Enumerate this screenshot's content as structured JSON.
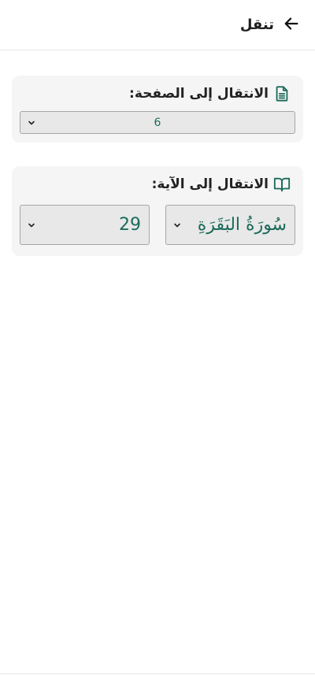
{
  "header": {
    "title": "تنقل",
    "back_icon": "arrow-left-icon"
  },
  "page_nav": {
    "label": "الانتقال إلى الصفحة:",
    "icon": "document-icon",
    "selected_page": "6"
  },
  "ayah_nav": {
    "label": "الانتقال إلى الآية:",
    "icon": "open-book-icon",
    "selected_surah": "سُورَةُ البَقَرَةِ",
    "selected_ayah": "29"
  },
  "colors": {
    "accent": "#1b6b5a",
    "card_bg": "#f5f5f5",
    "select_bg": "#e8e8e8"
  }
}
